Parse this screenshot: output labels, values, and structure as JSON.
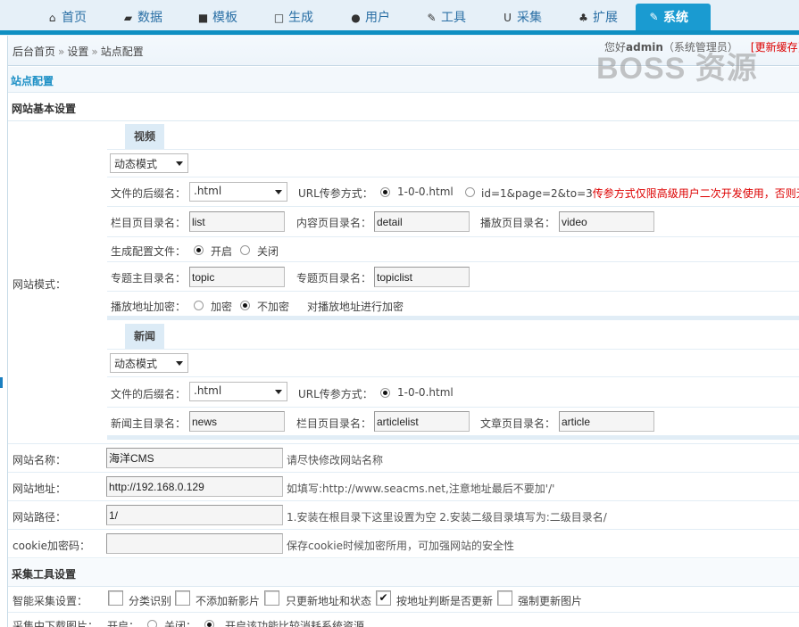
{
  "nav": {
    "items": [
      {
        "label": "首页",
        "icon": "home-icon",
        "glyph": "⌂"
      },
      {
        "label": "数据",
        "icon": "book-icon",
        "glyph": "▰"
      },
      {
        "label": "模板",
        "icon": "file-solid-icon",
        "glyph": "■"
      },
      {
        "label": "生成",
        "icon": "file-outline-icon",
        "glyph": "□"
      },
      {
        "label": "用户",
        "icon": "user-icon",
        "glyph": "●"
      },
      {
        "label": "工具",
        "icon": "wrench-icon",
        "glyph": "✎"
      },
      {
        "label": "采集",
        "icon": "magnet-icon",
        "glyph": "U"
      },
      {
        "label": "扩展",
        "icon": "sitemap-icon",
        "glyph": "♣"
      },
      {
        "label": "系统",
        "icon": "edit-icon",
        "glyph": "✎",
        "active": true
      }
    ]
  },
  "header": {
    "breadcrumb": [
      "后台首页",
      "设置",
      "站点配置"
    ],
    "breadcrumb_sep": "»",
    "greeting": "您好",
    "username": "admin",
    "role": "（系统管理员）",
    "refresh_cache": "[更新缓存]",
    "watermark": "BOSS 资源"
  },
  "page": {
    "section_title": "站点配置",
    "basic_group": "网站基本设置",
    "mode_label": "网站模式："
  },
  "video": {
    "tab": "视频",
    "mode_select": "动态模式",
    "suffix_label": "文件的后缀名：",
    "suffix_value": ".html",
    "url_label": "URL传参方式：",
    "url_opt1": "1-0-0.html",
    "url_opt2": "id=1&page=2&to=3",
    "url_warning": "传参方式仅限高级用户二次开发使用，否则无",
    "column_dir_label": "栏目页目录名：",
    "column_dir": "list",
    "content_dir_label": "内容页目录名：",
    "content_dir": "detail",
    "play_dir_label": "播放页目录名：",
    "play_dir": "video",
    "gen_config_label": "生成配置文件：",
    "gen_on": "开启",
    "gen_off": "关闭",
    "topic_main_label": "专题主目录名：",
    "topic_main": "topic",
    "topic_page_label": "专题页目录名：",
    "topic_page": "topiclist",
    "encrypt_label": "播放地址加密：",
    "encrypt_on": "加密",
    "encrypt_off": "不加密",
    "encrypt_hint": "对播放地址进行加密"
  },
  "news": {
    "tab": "新闻",
    "mode_select": "动态模式",
    "suffix_label": "文件的后缀名：",
    "suffix_value": ".html",
    "url_label": "URL传参方式：",
    "url_opt1": "1-0-0.html",
    "main_dir_label": "新闻主目录名：",
    "main_dir": "news",
    "column_dir_label": "栏目页目录名：",
    "column_dir": "articlelist",
    "article_dir_label": "文章页目录名：",
    "article_dir": "article"
  },
  "site": {
    "name_label": "网站名称：",
    "name_value": "海洋CMS",
    "name_hint": "请尽快修改网站名称",
    "url_label": "网站地址：",
    "url_value": "http://192.168.0.129",
    "url_hint": "如填写:http://www.seacms.net,注意地址最后不要加'/'",
    "path_label": "网站路径：",
    "path_value": "1/",
    "path_hint": "1.安装在根目录下这里设置为空 2.安装二级目录填写为:二级目录名/",
    "cookie_label": "cookie加密码：",
    "cookie_value": "",
    "cookie_hint": "保存cookie时候加密所用，可加强网站的安全性"
  },
  "collect": {
    "group": "采集工具设置",
    "smart_label": "智能采集设置：",
    "options": [
      {
        "label": "分类识别",
        "checked": false
      },
      {
        "label": "不添加新影片",
        "checked": false
      },
      {
        "label": "只更新地址和状态",
        "checked": false
      },
      {
        "label": "按地址判断是否更新",
        "checked": true
      },
      {
        "label": "强制更新图片",
        "checked": false
      }
    ],
    "download_label": "采集中下载图片：",
    "download_on": "开启：",
    "download_off": "关闭：",
    "download_hint": "开启该功能比较消耗系统资源"
  }
}
